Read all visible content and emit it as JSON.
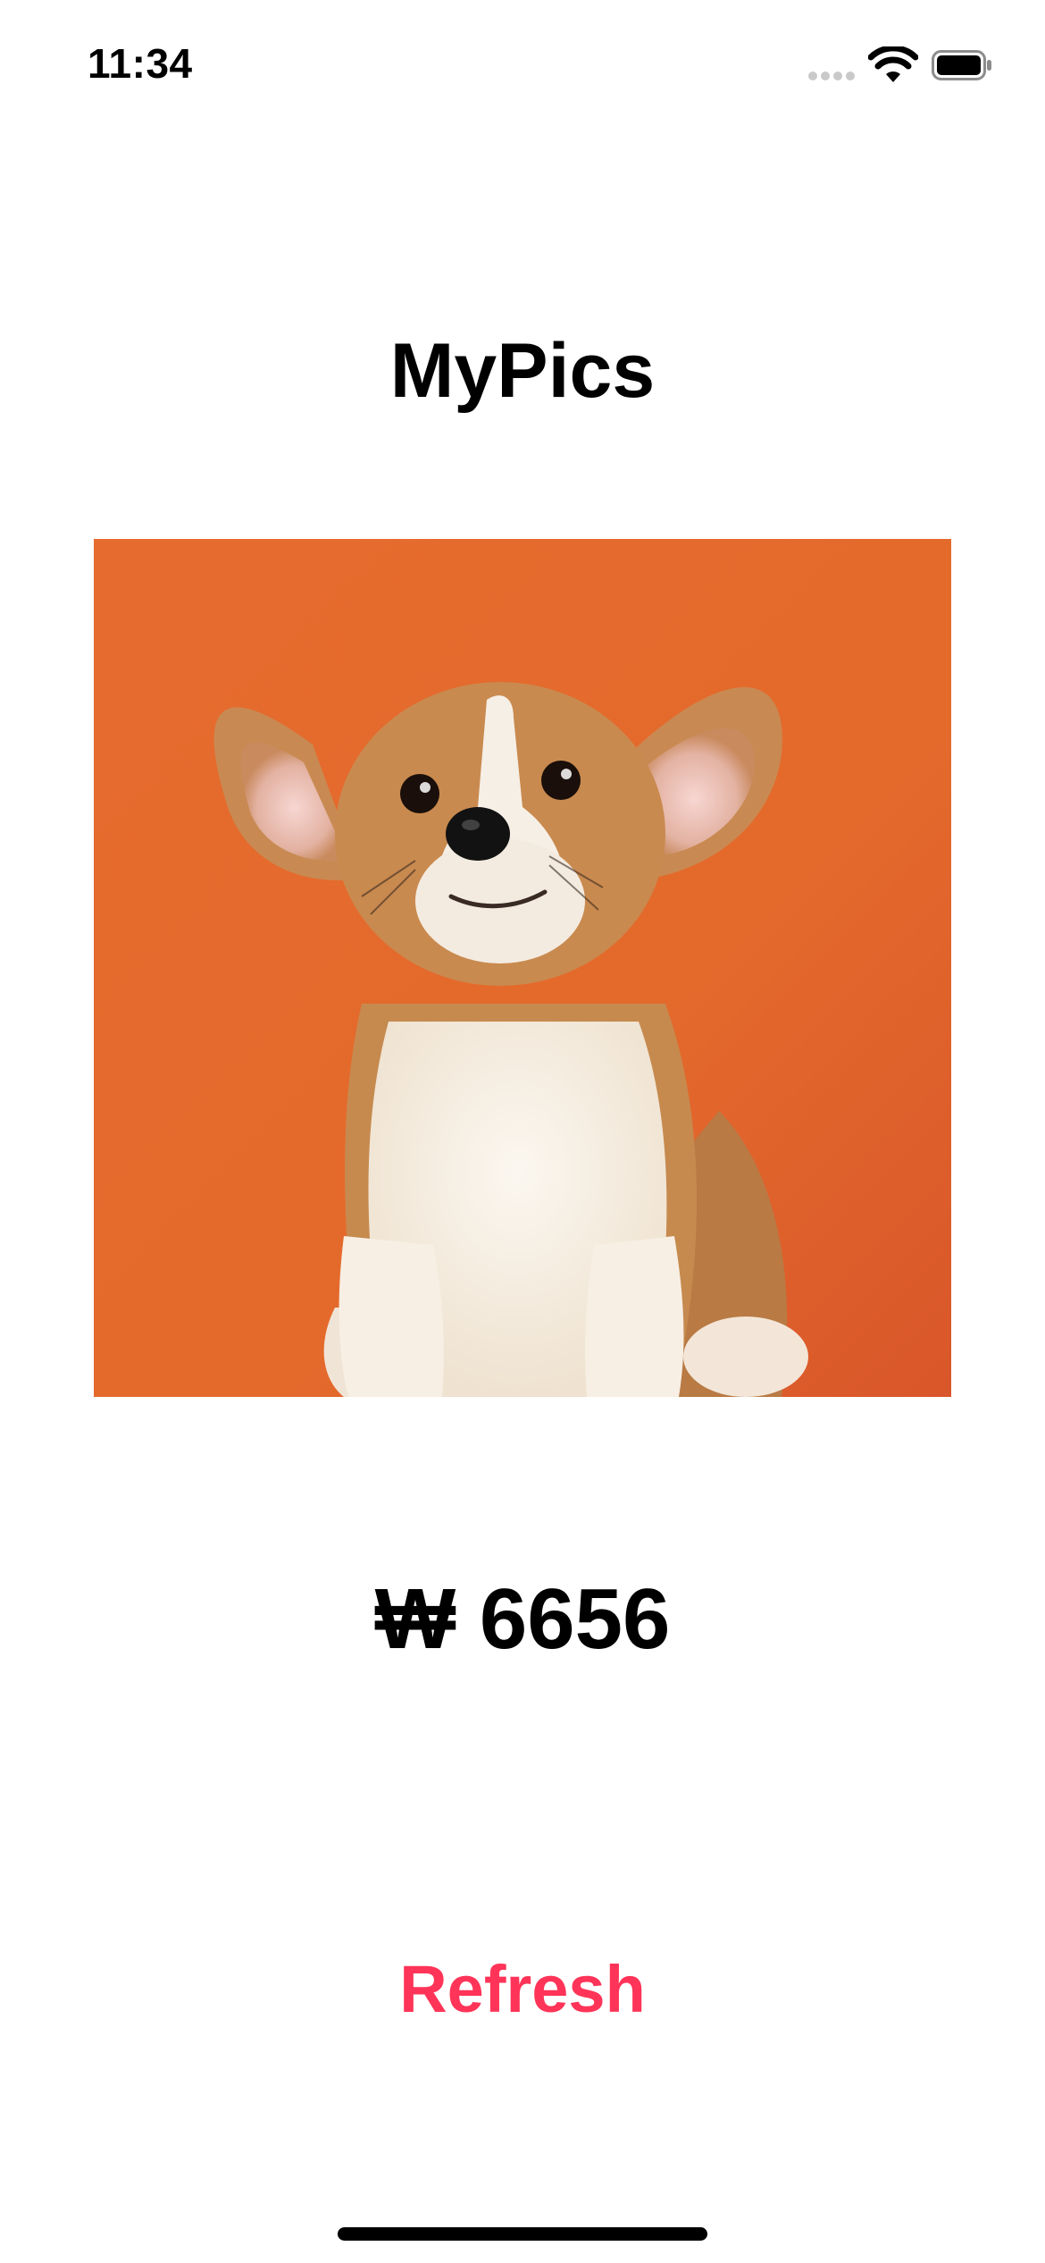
{
  "status_bar": {
    "time": "11:34",
    "icons": [
      "signal-dots-icon",
      "wifi-icon",
      "battery-icon"
    ]
  },
  "app": {
    "title": "MyPics"
  },
  "photo": {
    "subject": "corgi-puppy-photo",
    "background_color": "#e2672c"
  },
  "price": {
    "text": "₩ 6656"
  },
  "actions": {
    "refresh_label": "Refresh",
    "accent_color": "#ff3458"
  }
}
